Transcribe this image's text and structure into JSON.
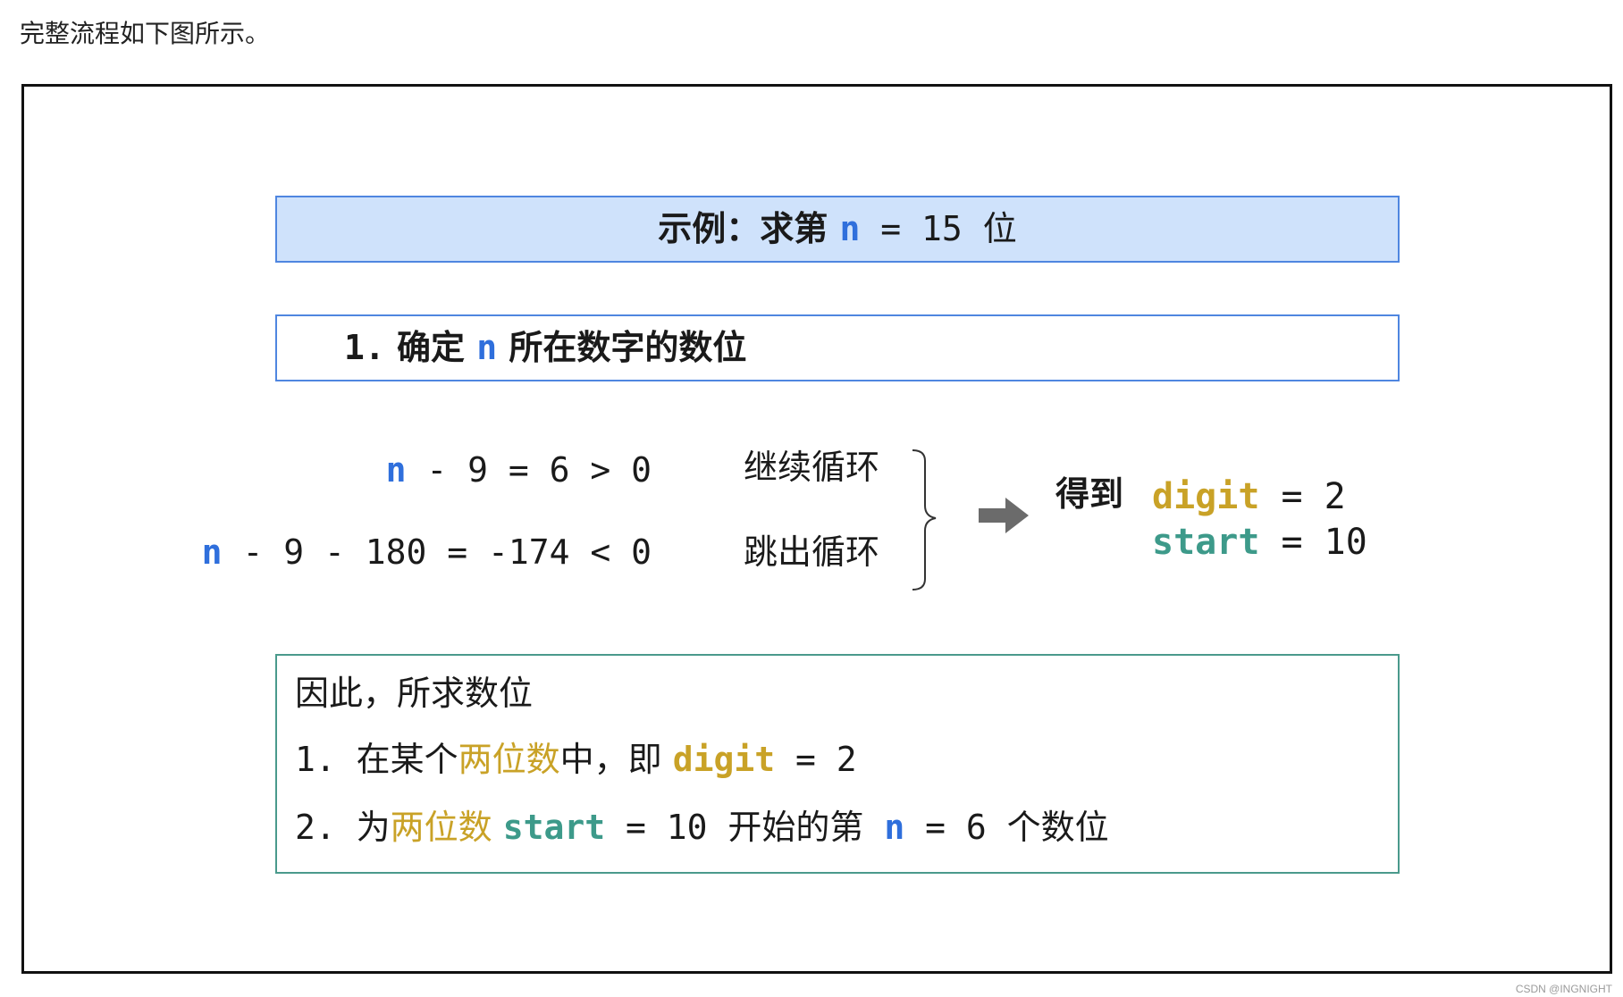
{
  "intro_text": "完整流程如下图所示。",
  "title": {
    "prefix": "示例：求第 ",
    "var": "n",
    "suffix": " = 15 位"
  },
  "step": {
    "number": "1.",
    "prefix": " 确定 ",
    "var": "n",
    "suffix": " 所在数字的数位"
  },
  "calc": {
    "line1": {
      "var": "n",
      "expr": " - 9 = 6 > 0",
      "note": "继续循环"
    },
    "line2": {
      "var": "n",
      "expr": " - 9 - 180 = -174 < 0",
      "note": "跳出循环"
    }
  },
  "result": {
    "label": "得到",
    "digit_name": "digit",
    "digit_eq": " = 2",
    "start_name": "start",
    "start_eq": " = 10"
  },
  "conclusion": {
    "heading": "因此，所求数位",
    "item1": {
      "num": "1. ",
      "text_a": "在某个",
      "highlight": "两位数",
      "text_b": "中，即 ",
      "var": "digit",
      "tail": " = 2"
    },
    "item2": {
      "num": "2. ",
      "text_a": "为",
      "highlight": "两位数",
      "space": " ",
      "var": "start",
      "mid": " = 10 开始的第 ",
      "var2": "n",
      "tail": " = 6 个数位"
    }
  },
  "watermark": "CSDN @INGNIGHT",
  "colors": {
    "title_bg": "#cfe2fb",
    "title_border": "#4f86e0",
    "var_blue": "#2f6fdc",
    "digit_gold": "#c9a227",
    "start_teal": "#3d9a8a",
    "conclusion_border": "#4a9a8c"
  }
}
